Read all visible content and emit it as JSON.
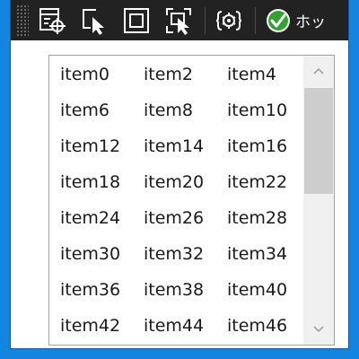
{
  "toolbar": {
    "buttons": [
      {
        "name": "select-element-icon"
      },
      {
        "name": "pick-pointer-icon"
      },
      {
        "name": "frame-square-icon"
      },
      {
        "name": "select-region-icon"
      },
      {
        "name": "settings-sync-icon"
      }
    ],
    "hot_label": "ホッ",
    "hot_icon": "check-circle-icon",
    "accent": "#2fa52f"
  },
  "listbox": {
    "items": [
      "item0",
      "item2",
      "item4",
      "item6",
      "item8",
      "item10",
      "item12",
      "item14",
      "item16",
      "item18",
      "item20",
      "item22",
      "item24",
      "item26",
      "item28",
      "item30",
      "item32",
      "item34",
      "item36",
      "item38",
      "item40",
      "item42",
      "item44",
      "item46"
    ],
    "columns": 3,
    "scroll_position": 0
  }
}
